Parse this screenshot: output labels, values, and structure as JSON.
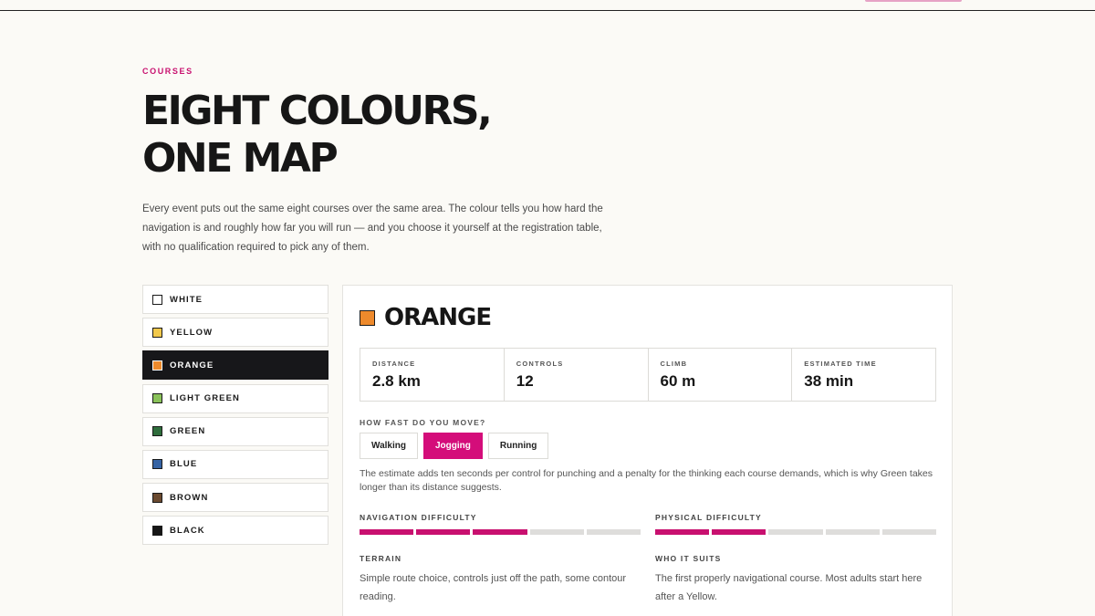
{
  "header": {
    "eyebrow": "COURSES"
  },
  "page": {
    "title_line1": "EIGHT COLOURS,",
    "title_line2": "ONE MAP",
    "intro": "Every event puts out the same eight courses over the same area. The colour tells you how hard the navigation is and roughly how far you will run — and you choose it yourself at the registration table, with no qualification required to pick any of them."
  },
  "courses": [
    {
      "label": "WHITE",
      "color": "#ffffff",
      "active": false
    },
    {
      "label": "YELLOW",
      "color": "#f2c94c",
      "active": false
    },
    {
      "label": "ORANGE",
      "color": "#ee8a2c",
      "active": true
    },
    {
      "label": "LIGHT GREEN",
      "color": "#8ac25a",
      "active": false
    },
    {
      "label": "GREEN",
      "color": "#2f6d3c",
      "active": false
    },
    {
      "label": "BLUE",
      "color": "#3563a4",
      "active": false
    },
    {
      "label": "BROWN",
      "color": "#6b4a30",
      "active": false
    },
    {
      "label": "BLACK",
      "color": "#161616",
      "active": false
    }
  ],
  "detail": {
    "title": "ORANGE",
    "color": "#ee8a2c",
    "stats": [
      {
        "label": "DISTANCE",
        "value": "2.8 km"
      },
      {
        "label": "CONTROLS",
        "value": "12"
      },
      {
        "label": "CLIMB",
        "value": "60 m"
      },
      {
        "label": "ESTIMATED TIME",
        "value": "38 min"
      }
    ],
    "speed_label": "HOW FAST DO YOU MOVE?",
    "speed_options": [
      {
        "label": "Walking",
        "active": false
      },
      {
        "label": "Jogging",
        "active": true
      },
      {
        "label": "Running",
        "active": false
      }
    ],
    "speed_note": "The estimate adds ten seconds per control for punching and a penalty for the thinking each course demands, which is why Green takes longer than its distance suggests.",
    "navigation": {
      "label": "NAVIGATION DIFFICULTY",
      "level": 3,
      "max": 5
    },
    "physical": {
      "label": "PHYSICAL DIFFICULTY",
      "level": 2,
      "max": 5
    },
    "terrain": {
      "label": "TERRAIN",
      "text": "Simple route choice, controls just off the path, some contour reading."
    },
    "suits": {
      "label": "WHO IT SUITS",
      "text": "The first properly navigational course. Most adults start here after a Yellow."
    }
  },
  "colors": {
    "accent": "#c8106f",
    "dark": "#17171a",
    "background": "#fbfaf6"
  }
}
